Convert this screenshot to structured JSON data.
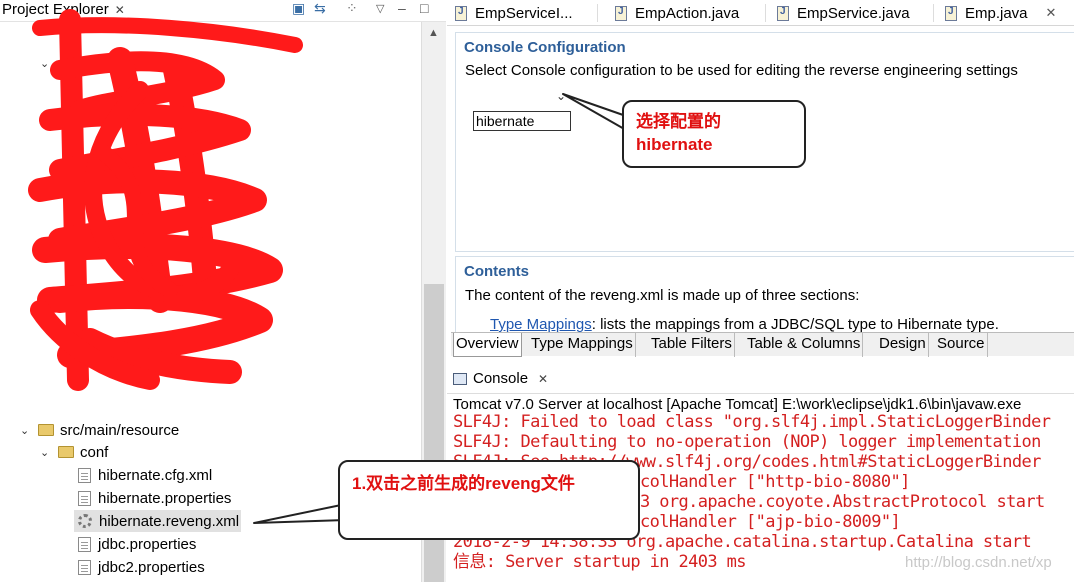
{
  "project_explorer": {
    "title": "Project Explorer",
    "close_glyph": "✕",
    "tree": [
      {
        "label": "src/main/resource",
        "indent": 0,
        "icon": "folder",
        "expanded": true
      },
      {
        "label": "conf",
        "indent": 1,
        "icon": "folder",
        "expanded": true
      },
      {
        "label": "hibernate.cfg.xml",
        "indent": 2,
        "icon": "xml-file"
      },
      {
        "label": "hibernate.properties",
        "indent": 2,
        "icon": "file"
      },
      {
        "label": "hibernate.reveng.xml",
        "indent": 2,
        "icon": "reveng-file",
        "selected": true
      },
      {
        "label": "jdbc.properties",
        "indent": 2,
        "icon": "file"
      },
      {
        "label": "jdbc2.properties",
        "indent": 2,
        "icon": "file"
      }
    ]
  },
  "editor_tabs": [
    {
      "label": "EmpServiceI...",
      "icon": "java-file-icon"
    },
    {
      "label": "EmpAction.java",
      "icon": "java-file-icon"
    },
    {
      "label": "EmpService.java",
      "icon": "java-file-icon"
    },
    {
      "label": "Emp.java",
      "icon": "java-file-icon",
      "closable": true
    }
  ],
  "console_config": {
    "title": "Console Configuration",
    "description": "Select Console configuration to be used for editing the reverse engineering settings",
    "selected": "hibernate"
  },
  "contents": {
    "title": "Contents",
    "description": "The content of the reveng.xml is made up of three sections:",
    "item_link": "Type Mappings",
    "item_text": ": lists the mappings from a JDBC/SQL type to Hibernate type."
  },
  "page_tabs": [
    "Overview",
    "Type Mappings",
    "Table Filters",
    "Table & Columns",
    "Design",
    "Source"
  ],
  "active_page_tab": "Overview",
  "console": {
    "tab_label": "Console",
    "description": "Tomcat v7.0 Server at localhost [Apache Tomcat] E:\\work\\eclipse\\jdk1.6\\bin\\javaw.exe",
    "lines": [
      "SLF4J: Failed to load class \"org.slf4j.impl.StaticLoggerBinder",
      "SLF4J: Defaulting to no-operation (NOP) logger implementation",
      "SLF4J: See http://www.slf4j.org/codes.html#StaticLoggerBinder",
      "信息: Starting ProtocolHandler [\"http-bio-8080\"]",
      "二月 09, 2018 2:38:33 org.apache.coyote.AbstractProtocol start",
      "信息: Starting ProtocolHandler [\"ajp-bio-8009\"]",
      "2018-2-9 14:38:33 org.apache.catalina.startup.Catalina start",
      "信息: Server startup in 2403 ms"
    ]
  },
  "callouts": {
    "config": {
      "line1": "选择配置的",
      "line2": "hibernate"
    },
    "reveng": {
      "text": "1.双击之前生成的reveng文件"
    }
  },
  "watermark": "http://blog.csdn.net/xp"
}
